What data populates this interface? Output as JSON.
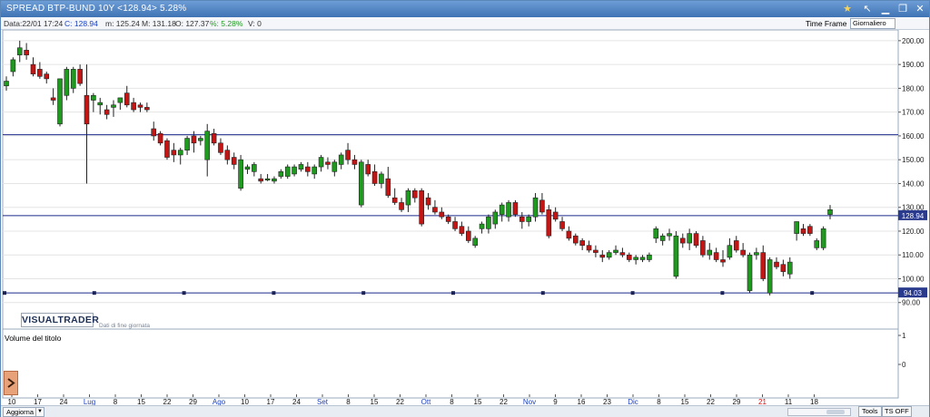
{
  "window": {
    "title": "SPREAD BTP-BUND 10Y <128.94> 5.28%"
  },
  "infobar": {
    "data": "Data:22/01 17:24",
    "close": "C: 128.94",
    "min": "m: 125.24",
    "max": "M: 131.18",
    "open": "O: 127.37",
    "pct": "%: 5.28%",
    "vol": "V: 0",
    "timeframe_label": "Time Frame",
    "timeframe_value": "Giornaliero"
  },
  "logo": {
    "text": "VISUALTRADER",
    "subtitle": "Dati di fine giornata"
  },
  "volume_panel": {
    "label": "Volume del titolo",
    "ticks": [
      "1",
      "0"
    ]
  },
  "statusbar": {
    "refresh": "Aggiorna",
    "tools": "Tools",
    "ts_off": "TS OFF"
  },
  "colors": {
    "up": "#1e9a1e",
    "down": "#c41515",
    "hline": "#1c2a8c",
    "title_bar": "#4a7fc0",
    "price_box": "#2a3a8c",
    "pct_up": "#1e9a1e",
    "close_blue": "#1a3fc2"
  },
  "chart_data": {
    "type": "candlestick",
    "ylim": [
      88,
      203
    ],
    "y_ticks": [
      90,
      100,
      110,
      120,
      130,
      140,
      150,
      160,
      170,
      180,
      190,
      200
    ],
    "y_tick_labels": [
      "90.00",
      "100.00",
      "110.00",
      "120.00",
      "130.00",
      "140.00",
      "150.00",
      "160.00",
      "170.00",
      "180.00",
      "190.00",
      "200.00"
    ],
    "horizontal_lines": [
      160.5,
      126.5,
      94.03
    ],
    "price_labels": [
      "128.94",
      "94.03"
    ],
    "x_axis": [
      {
        "label": "10",
        "month": false
      },
      {
        "label": "17",
        "month": false
      },
      {
        "label": "24",
        "month": false
      },
      {
        "label": "Lug",
        "month": true
      },
      {
        "label": "8",
        "month": false
      },
      {
        "label": "15",
        "month": false
      },
      {
        "label": "22",
        "month": false
      },
      {
        "label": "29",
        "month": false
      },
      {
        "label": "Ago",
        "month": true
      },
      {
        "label": "10",
        "month": false
      },
      {
        "label": "17",
        "month": false
      },
      {
        "label": "24",
        "month": false
      },
      {
        "label": "Set",
        "month": true
      },
      {
        "label": "8",
        "month": false
      },
      {
        "label": "15",
        "month": false
      },
      {
        "label": "22",
        "month": false
      },
      {
        "label": "Ott",
        "month": true
      },
      {
        "label": "8",
        "month": false
      },
      {
        "label": "15",
        "month": false
      },
      {
        "label": "22",
        "month": false
      },
      {
        "label": "Nov",
        "month": true
      },
      {
        "label": "9",
        "month": false
      },
      {
        "label": "16",
        "month": false
      },
      {
        "label": "23",
        "month": false
      },
      {
        "label": "Dic",
        "month": true
      },
      {
        "label": "8",
        "month": false
      },
      {
        "label": "15",
        "month": false
      },
      {
        "label": "22",
        "month": false
      },
      {
        "label": "29",
        "month": false
      },
      {
        "label": "21",
        "month": false,
        "red": true
      },
      {
        "label": "11",
        "month": false
      },
      {
        "label": "18",
        "month": false
      }
    ],
    "candles": [
      {
        "o": 181,
        "h": 185,
        "l": 179,
        "c": 183
      },
      {
        "o": 187,
        "h": 193,
        "l": 185,
        "c": 192
      },
      {
        "o": 194,
        "h": 200,
        "l": 191,
        "c": 197
      },
      {
        "o": 196,
        "h": 199,
        "l": 192,
        "c": 194
      },
      {
        "o": 190,
        "h": 193,
        "l": 185,
        "c": 186
      },
      {
        "o": 188,
        "h": 191,
        "l": 184,
        "c": 185
      },
      {
        "o": 186,
        "h": 187,
        "l": 182,
        "c": 184
      },
      {
        "o": 176,
        "h": 180,
        "l": 173,
        "c": 175
      },
      {
        "o": 165,
        "h": 182,
        "l": 164,
        "c": 184
      },
      {
        "o": 177,
        "h": 189,
        "l": 175,
        "c": 188
      },
      {
        "o": 180,
        "h": 189,
        "l": 178,
        "c": 188
      },
      {
        "o": 188,
        "h": 190,
        "l": 181,
        "c": 182
      },
      {
        "o": 177,
        "h": 190,
        "l": 140,
        "c": 165
      },
      {
        "o": 175,
        "h": 178,
        "l": 170,
        "c": 177
      },
      {
        "o": 173,
        "h": 176,
        "l": 169,
        "c": 174
      },
      {
        "o": 171,
        "h": 173,
        "l": 167,
        "c": 169
      },
      {
        "o": 172,
        "h": 175,
        "l": 168,
        "c": 173
      },
      {
        "o": 174,
        "h": 176,
        "l": 171,
        "c": 176
      },
      {
        "o": 178,
        "h": 181,
        "l": 172,
        "c": 173
      },
      {
        "o": 174,
        "h": 176,
        "l": 170,
        "c": 171
      },
      {
        "o": 173,
        "h": 174,
        "l": 170,
        "c": 172
      },
      {
        "o": 172,
        "h": 174,
        "l": 170,
        "c": 171
      },
      {
        "o": 163,
        "h": 166,
        "l": 158,
        "c": 160
      },
      {
        "o": 161,
        "h": 162,
        "l": 156,
        "c": 157
      },
      {
        "o": 158,
        "h": 159,
        "l": 150,
        "c": 151
      },
      {
        "o": 154,
        "h": 157,
        "l": 149,
        "c": 152
      },
      {
        "o": 152,
        "h": 155,
        "l": 148,
        "c": 154
      },
      {
        "o": 154,
        "h": 160,
        "l": 152,
        "c": 159
      },
      {
        "o": 160,
        "h": 162,
        "l": 153,
        "c": 157
      },
      {
        "o": 158,
        "h": 160,
        "l": 156,
        "c": 159
      },
      {
        "o": 150,
        "h": 165,
        "l": 143,
        "c": 162
      },
      {
        "o": 161,
        "h": 163,
        "l": 156,
        "c": 157
      },
      {
        "o": 157,
        "h": 159,
        "l": 152,
        "c": 153
      },
      {
        "o": 154,
        "h": 156,
        "l": 148,
        "c": 150
      },
      {
        "o": 151,
        "h": 153,
        "l": 146,
        "c": 148
      },
      {
        "o": 138,
        "h": 152,
        "l": 137,
        "c": 150
      },
      {
        "o": 146,
        "h": 148,
        "l": 144,
        "c": 147
      },
      {
        "o": 145,
        "h": 149,
        "l": 143,
        "c": 148
      },
      {
        "o": 142,
        "h": 144,
        "l": 140,
        "c": 141
      },
      {
        "o": 142,
        "h": 144,
        "l": 141,
        "c": 142
      },
      {
        "o": 141,
        "h": 143,
        "l": 140,
        "c": 142
      },
      {
        "o": 143,
        "h": 146,
        "l": 142,
        "c": 145
      },
      {
        "o": 143,
        "h": 148,
        "l": 142,
        "c": 147
      },
      {
        "o": 144,
        "h": 148,
        "l": 143,
        "c": 147
      },
      {
        "o": 146,
        "h": 149,
        "l": 145,
        "c": 148
      },
      {
        "o": 147,
        "h": 149,
        "l": 143,
        "c": 145
      },
      {
        "o": 144,
        "h": 148,
        "l": 142,
        "c": 147
      },
      {
        "o": 147,
        "h": 152,
        "l": 145,
        "c": 151
      },
      {
        "o": 149,
        "h": 151,
        "l": 146,
        "c": 148
      },
      {
        "o": 145,
        "h": 150,
        "l": 143,
        "c": 149
      },
      {
        "o": 148,
        "h": 153,
        "l": 146,
        "c": 152
      },
      {
        "o": 154,
        "h": 157,
        "l": 148,
        "c": 150
      },
      {
        "o": 150,
        "h": 152,
        "l": 146,
        "c": 148
      },
      {
        "o": 131,
        "h": 150,
        "l": 130,
        "c": 149
      },
      {
        "o": 148,
        "h": 150,
        "l": 143,
        "c": 144
      },
      {
        "o": 145,
        "h": 148,
        "l": 139,
        "c": 140
      },
      {
        "o": 140,
        "h": 145,
        "l": 138,
        "c": 144
      },
      {
        "o": 142,
        "h": 147,
        "l": 134,
        "c": 135
      },
      {
        "o": 134,
        "h": 138,
        "l": 131,
        "c": 132
      },
      {
        "o": 132,
        "h": 134,
        "l": 128,
        "c": 129
      },
      {
        "o": 131,
        "h": 138,
        "l": 128,
        "c": 137
      },
      {
        "o": 137,
        "h": 138,
        "l": 132,
        "c": 134
      },
      {
        "o": 137,
        "h": 138,
        "l": 122,
        "c": 123
      },
      {
        "o": 134,
        "h": 136,
        "l": 129,
        "c": 131
      },
      {
        "o": 130,
        "h": 133,
        "l": 127,
        "c": 128
      },
      {
        "o": 128,
        "h": 130,
        "l": 125,
        "c": 126
      },
      {
        "o": 126,
        "h": 127,
        "l": 123,
        "c": 124
      },
      {
        "o": 124,
        "h": 126,
        "l": 120,
        "c": 121
      },
      {
        "o": 122,
        "h": 124,
        "l": 118,
        "c": 119
      },
      {
        "o": 120,
        "h": 122,
        "l": 115,
        "c": 116
      },
      {
        "o": 114,
        "h": 118,
        "l": 113,
        "c": 117
      },
      {
        "o": 121,
        "h": 124,
        "l": 119,
        "c": 123
      },
      {
        "o": 121,
        "h": 127,
        "l": 119,
        "c": 126
      },
      {
        "o": 123,
        "h": 129,
        "l": 121,
        "c": 128
      },
      {
        "o": 127,
        "h": 132,
        "l": 124,
        "c": 131
      },
      {
        "o": 126,
        "h": 133,
        "l": 124,
        "c": 132
      },
      {
        "o": 132,
        "h": 133,
        "l": 126,
        "c": 127
      },
      {
        "o": 126,
        "h": 128,
        "l": 121,
        "c": 124
      },
      {
        "o": 124,
        "h": 127,
        "l": 122,
        "c": 126
      },
      {
        "o": 126,
        "h": 136,
        "l": 124,
        "c": 134
      },
      {
        "o": 133,
        "h": 136,
        "l": 127,
        "c": 128
      },
      {
        "o": 129,
        "h": 131,
        "l": 117,
        "c": 118
      },
      {
        "o": 128,
        "h": 130,
        "l": 124,
        "c": 125
      },
      {
        "o": 124,
        "h": 126,
        "l": 120,
        "c": 121
      },
      {
        "o": 120,
        "h": 122,
        "l": 116,
        "c": 117
      },
      {
        "o": 118,
        "h": 119,
        "l": 114,
        "c": 115
      },
      {
        "o": 116,
        "h": 117,
        "l": 112,
        "c": 114
      },
      {
        "o": 114,
        "h": 116,
        "l": 111,
        "c": 112
      },
      {
        "o": 112,
        "h": 114,
        "l": 109,
        "c": 111
      },
      {
        "o": 110,
        "h": 112,
        "l": 107,
        "c": 109
      },
      {
        "o": 109,
        "h": 112,
        "l": 108,
        "c": 111
      },
      {
        "o": 111,
        "h": 114,
        "l": 110,
        "c": 112
      },
      {
        "o": 111,
        "h": 113,
        "l": 109,
        "c": 110
      },
      {
        "o": 110,
        "h": 111,
        "l": 107,
        "c": 108
      },
      {
        "o": 108,
        "h": 110,
        "l": 106,
        "c": 109
      },
      {
        "o": 108,
        "h": 110,
        "l": 107,
        "c": 109
      },
      {
        "o": 108,
        "h": 111,
        "l": 107,
        "c": 110
      },
      {
        "o": 117,
        "h": 122,
        "l": 115,
        "c": 121
      },
      {
        "o": 116,
        "h": 119,
        "l": 114,
        "c": 118
      },
      {
        "o": 118,
        "h": 121,
        "l": 116,
        "c": 119
      },
      {
        "o": 101,
        "h": 120,
        "l": 100,
        "c": 118
      },
      {
        "o": 117,
        "h": 119,
        "l": 113,
        "c": 115
      },
      {
        "o": 115,
        "h": 121,
        "l": 112,
        "c": 119
      },
      {
        "o": 119,
        "h": 120,
        "l": 113,
        "c": 114
      },
      {
        "o": 116,
        "h": 118,
        "l": 109,
        "c": 110
      },
      {
        "o": 110,
        "h": 115,
        "l": 108,
        "c": 112
      },
      {
        "o": 111,
        "h": 113,
        "l": 107,
        "c": 108
      },
      {
        "o": 108,
        "h": 112,
        "l": 105,
        "c": 107
      },
      {
        "o": 109,
        "h": 117,
        "l": 108,
        "c": 114
      },
      {
        "o": 116,
        "h": 118,
        "l": 111,
        "c": 112
      },
      {
        "o": 112,
        "h": 115,
        "l": 109,
        "c": 110
      },
      {
        "o": 95,
        "h": 111,
        "l": 94,
        "c": 110
      },
      {
        "o": 110,
        "h": 113,
        "l": 108,
        "c": 111
      },
      {
        "o": 111,
        "h": 114,
        "l": 99,
        "c": 100
      },
      {
        "o": 94,
        "h": 109,
        "l": 93,
        "c": 108
      },
      {
        "o": 107,
        "h": 109,
        "l": 104,
        "c": 105
      },
      {
        "o": 106,
        "h": 108,
        "l": 101,
        "c": 103
      },
      {
        "o": 102,
        "h": 109,
        "l": 100,
        "c": 107
      },
      {
        "o": 119,
        "h": 124,
        "l": 116,
        "c": 124
      },
      {
        "o": 121,
        "h": 123,
        "l": 118,
        "c": 119
      },
      {
        "o": 122,
        "h": 123,
        "l": 118,
        "c": 119
      },
      {
        "o": 113,
        "h": 117,
        "l": 112,
        "c": 116
      },
      {
        "o": 113,
        "h": 122,
        "l": 112,
        "c": 121
      },
      {
        "o": 127,
        "h": 131,
        "l": 125,
        "c": 129
      }
    ]
  }
}
